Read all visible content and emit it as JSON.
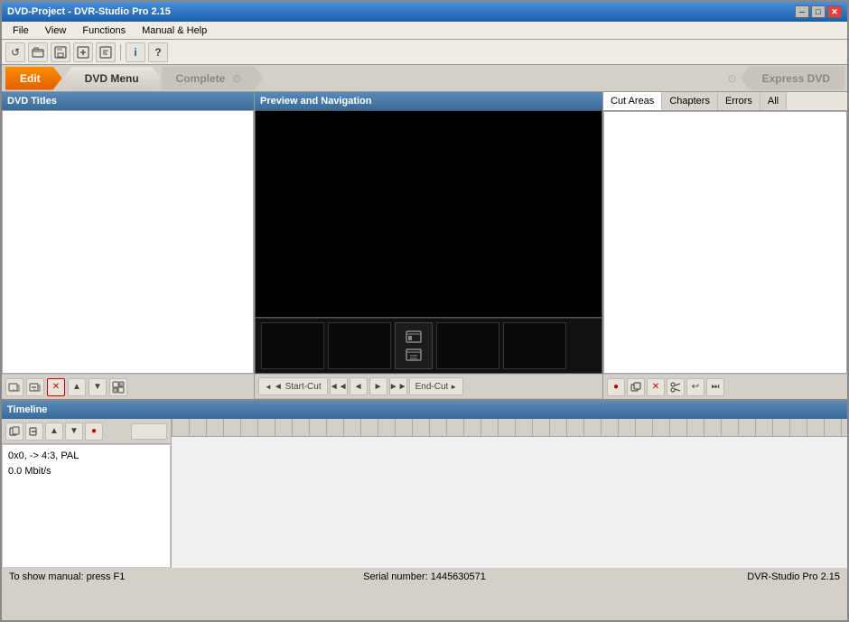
{
  "window": {
    "title": "DVD-Project - DVR-Studio Pro 2.15",
    "minimize_label": "─",
    "maximize_label": "□",
    "close_label": "✕"
  },
  "menubar": {
    "items": [
      "File",
      "View",
      "Functions",
      "Manual & Help"
    ]
  },
  "toolbar": {
    "buttons": [
      {
        "name": "refresh-icon",
        "icon": "↺"
      },
      {
        "name": "open-icon",
        "icon": "📂"
      },
      {
        "name": "save-icon",
        "icon": "💾"
      },
      {
        "name": "add-icon",
        "icon": "➕"
      },
      {
        "name": "export-icon",
        "icon": "📤"
      },
      {
        "name": "info-icon",
        "icon": "ℹ"
      },
      {
        "name": "help-icon",
        "icon": "?"
      }
    ]
  },
  "workflow": {
    "tabs": [
      {
        "id": "edit",
        "label": "Edit",
        "state": "active"
      },
      {
        "id": "dvd-menu",
        "label": "DVD Menu",
        "state": "normal"
      },
      {
        "id": "complete",
        "label": "Complete",
        "state": "inactive"
      },
      {
        "id": "express-dvd",
        "label": "Express DVD",
        "state": "inactive"
      }
    ]
  },
  "panels": {
    "dvd_titles": {
      "header": "DVD Titles"
    },
    "preview": {
      "header": "Preview and Navigation"
    },
    "right": {
      "tabs": [
        "Cut Areas",
        "Chapters",
        "Errors",
        "All"
      ]
    }
  },
  "left_controls": {
    "buttons": [
      "⊞",
      "⊟",
      "✕",
      "▲",
      "▼",
      "⊡"
    ]
  },
  "preview_controls": {
    "start_cut": "◄ Start-Cut",
    "rewind": "◄◄",
    "back": "◄",
    "play": "►",
    "forward": "►►",
    "end_cut": "End-Cut ►",
    "extra_buttons": [
      "●",
      "📋",
      "✕",
      "✂",
      "↩",
      "⏭"
    ]
  },
  "right_controls": {
    "buttons": [
      "●",
      "📋",
      "✕",
      "✂",
      "↩",
      "⏭"
    ]
  },
  "timeline": {
    "header": "Timeline",
    "transport_buttons": [
      "⊞",
      "⊟",
      "▲",
      "▼",
      "●"
    ],
    "info": {
      "line1": "0x0,  -> 4:3, PAL",
      "line2": "0.0 Mbit/s"
    }
  },
  "statusbar": {
    "left": "To show manual: press F1",
    "center": "Serial number: 1445630571",
    "right": "DVR-Studio Pro 2.15"
  }
}
